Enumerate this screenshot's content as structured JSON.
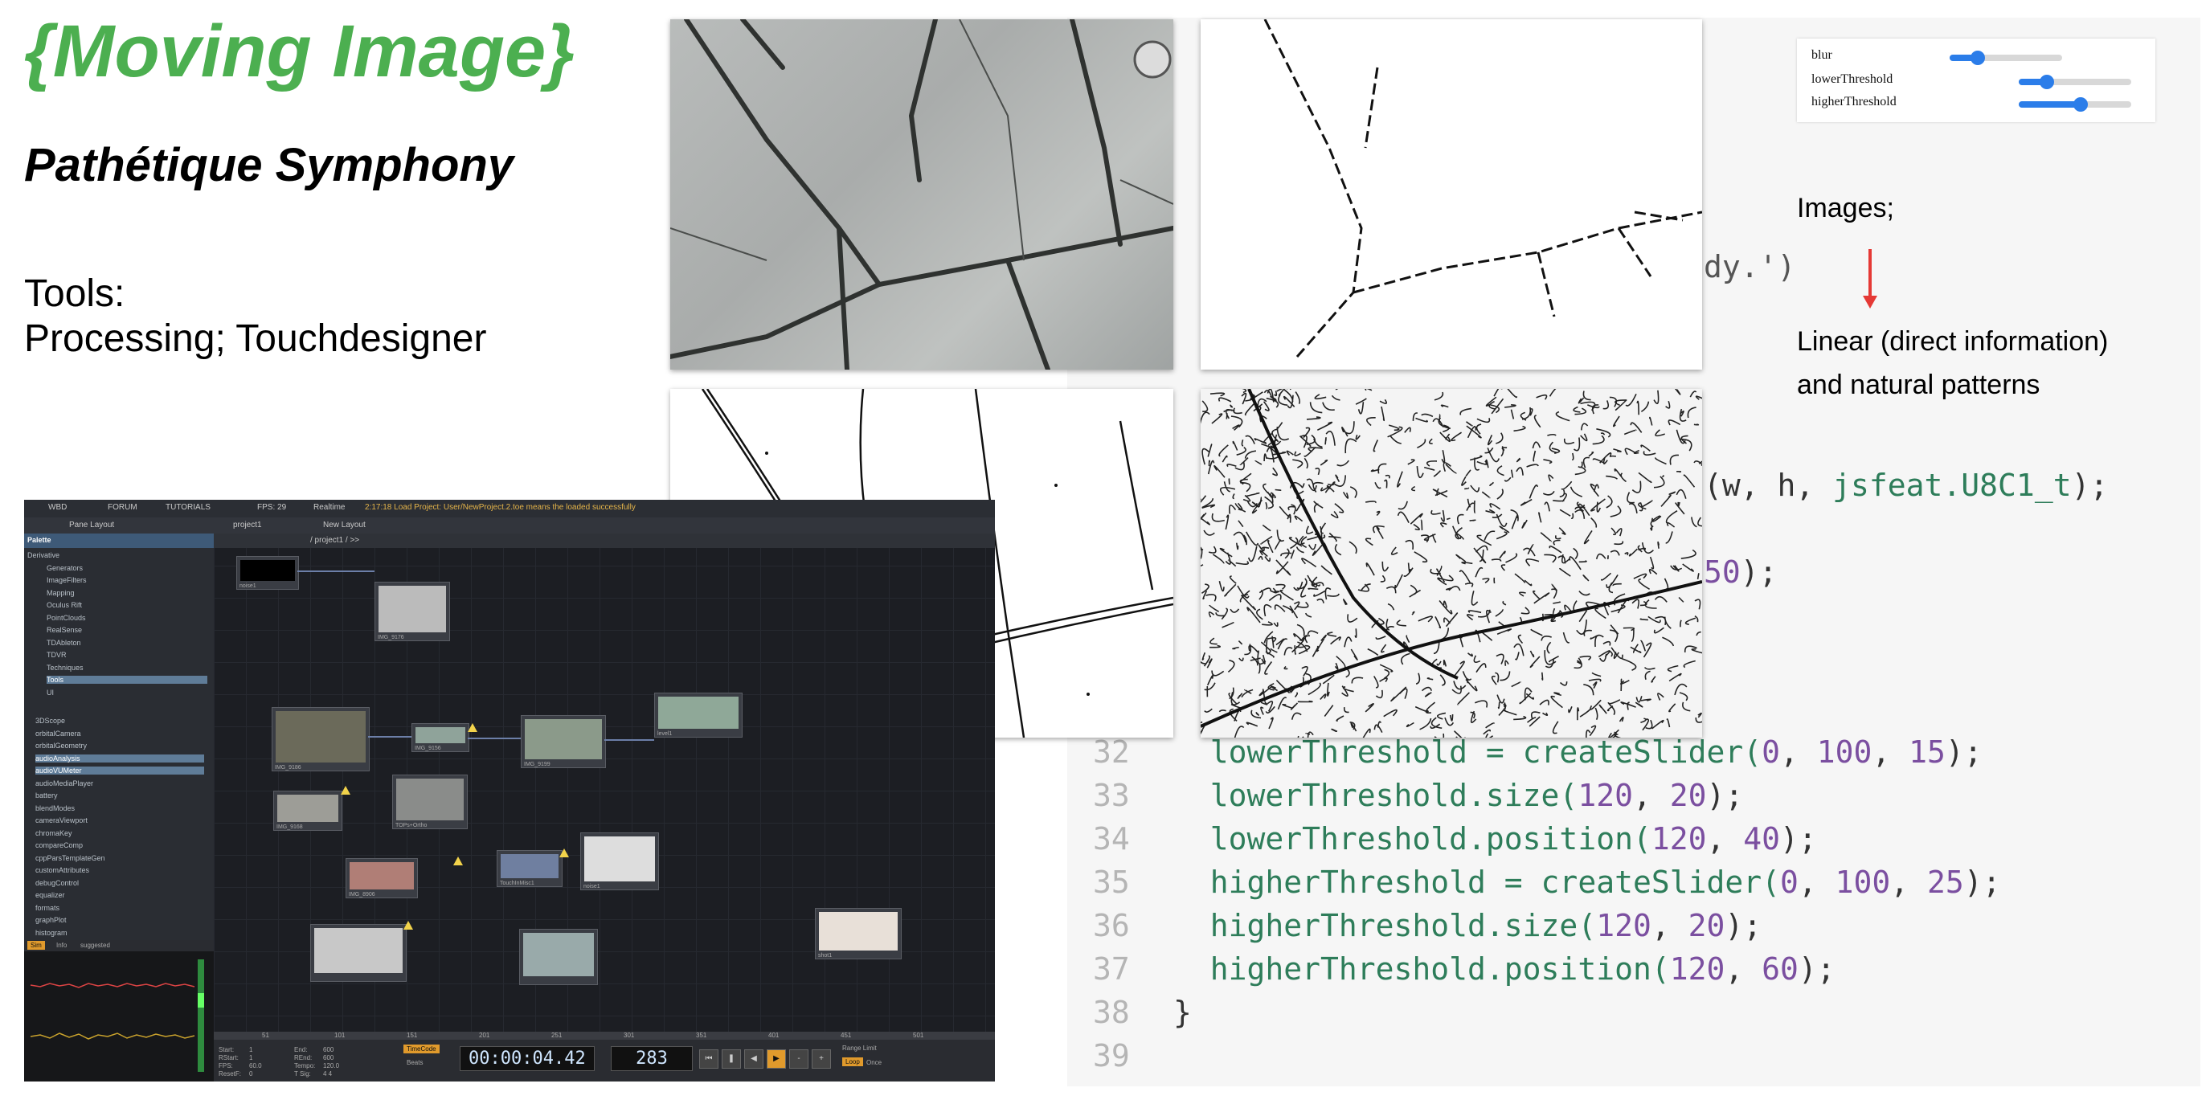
{
  "slide": {
    "title": "{Moving Image}",
    "subtitle": "Pathétique Symphony",
    "tools_label": "Tools:",
    "tools_list": "Processing; Touchdesigner"
  },
  "sliders": [
    {
      "label": "blur",
      "fraction": 0.25
    },
    {
      "label": "lowerThreshold",
      "fraction": 0.25
    },
    {
      "label": "higherThreshold",
      "fraction": 0.55
    }
  ],
  "annotation": {
    "images": "Images;",
    "linear_line1": "Linear (direct information)",
    "linear_line2": "and natural patterns"
  },
  "code": {
    "frag_ready": "dy.')",
    "frag_matrix_pre": "(w, h, ",
    "frag_matrix_type": "jsfeat.U8C1_t",
    "frag_matrix_post": ");",
    "frag_50_num": "50",
    "frag_50_post": ");",
    "lines": [
      {
        "n": "32",
        "pre": "  lowerThreshold = createSlider(",
        "a": "0",
        "b": "100",
        "c": "15",
        "post": ");"
      },
      {
        "n": "33",
        "pre": "  lowerThreshold.size(",
        "a": "120",
        "b": "20",
        "c": "",
        "post": ");"
      },
      {
        "n": "34",
        "pre": "  lowerThreshold.position(",
        "a": "120",
        "b": "40",
        "c": "",
        "post": ");"
      },
      {
        "n": "35",
        "pre": "  higherThreshold = createSlider(",
        "a": "0",
        "b": "100",
        "c": "25",
        "post": ");"
      },
      {
        "n": "36",
        "pre": "  higherThreshold.size(",
        "a": "120",
        "b": "20",
        "c": "",
        "post": ");"
      },
      {
        "n": "37",
        "pre": "  higherThreshold.position(",
        "a": "120",
        "b": "60",
        "c": "",
        "post": ");"
      },
      {
        "n": "38",
        "brace": "}"
      },
      {
        "n": "39",
        "brace": ""
      }
    ]
  },
  "touchdesigner": {
    "menu": [
      "WBD",
      "FORUM",
      "TUTORIALS",
      "FPS: 29",
      "Realtime",
      "2:17:18 Load Project: User/NewProject.2.toe means the loaded successfully"
    ],
    "pane_layout": "Pane Layout",
    "tab_project": "project1",
    "tab_new_layout": "New Layout",
    "path": "/ project1 / >>",
    "palette_title": "Palette",
    "palette_items": [
      "Derivative",
      "Generators",
      "ImageFilters",
      "Mapping",
      "Oculus Rift",
      "PointClouds",
      "RealSense",
      "TDAbleton",
      "TDVR",
      "Techniques",
      "Tools",
      "UI"
    ],
    "component_items": [
      "3DScope",
      "orbitalCamera",
      "orbitalGeometry",
      "audioAnalysis",
      "audioVUMeter",
      "audioMediaPlayer",
      "battery",
      "blendModes",
      "cameraViewport",
      "chromaKey",
      "compareComp",
      "cppParsTemplateGen",
      "customAttributes",
      "debugControl",
      "equalizer",
      "formats",
      "graphPlot",
      "histogram"
    ],
    "graph_tabs": [
      "Sim",
      "Info",
      "suggested"
    ],
    "timecode": "00:00:04.42",
    "frame": "283",
    "timecode_btn": "TimeCode",
    "beats_btn": "Beats",
    "range_limit": "Range Limit",
    "loop_btn": "Loop",
    "once_btn": "Once",
    "start_label": "Start:",
    "start_val": "1",
    "end_label": "End:",
    "end_val": "600",
    "rstart_label": "RStart:",
    "rstart_val": "1",
    "rend_label": "REnd:",
    "rend_val": "600",
    "fps_label": "FPS:",
    "fps_val": "60.0",
    "tempo_label": "Tempo:",
    "tempo_val": "120.0",
    "resetf_label": "ResetF:",
    "resetf_val": "0",
    "tsig_label": "T Sig:",
    "tsig_val": "4   4",
    "nodes": [
      "noise1",
      "IMG_9176",
      "IMG_9186",
      "IMG_9156",
      "IMG_9199",
      "IMG_9168",
      "TOPs+Ortho",
      "level1",
      "IMG_8906",
      "TouchInMisc1",
      "noise1",
      "shot1"
    ],
    "ruler": [
      "51",
      "101",
      "151",
      "201",
      "251",
      "301",
      "351",
      "401",
      "451",
      "501"
    ]
  }
}
